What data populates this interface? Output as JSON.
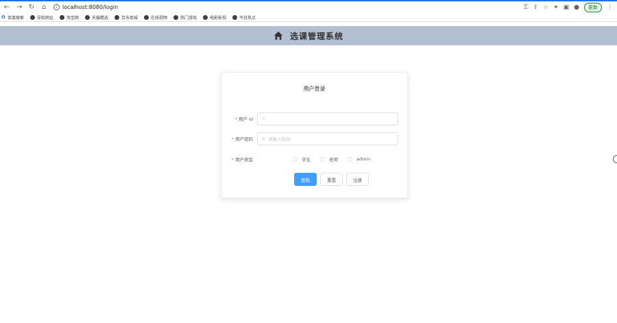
{
  "browser": {
    "url": "localhost:8080/login",
    "update_label": "更新",
    "bookmarks": [
      "百度搜索",
      "导航网址",
      "淘宝网",
      "天猫精选",
      "京东商城",
      "在线视频",
      "热门游戏",
      "电影影视",
      "今日热点"
    ]
  },
  "header": {
    "title": "选课管理系统",
    "icon": "home-icon",
    "bg_color": "#b3c0d1"
  },
  "login": {
    "title": "用户登录",
    "fields": {
      "user_id_label": "用户 id",
      "user_id_value": "",
      "password_label": "用户密码",
      "password_placeholder": "请输入密码"
    },
    "user_type_label": "用户类型",
    "user_types": [
      "学生",
      "老师",
      "admin"
    ],
    "buttons": {
      "login": "登陆",
      "reset": "重置",
      "register": "注册"
    },
    "primary_color": "#409eff"
  }
}
